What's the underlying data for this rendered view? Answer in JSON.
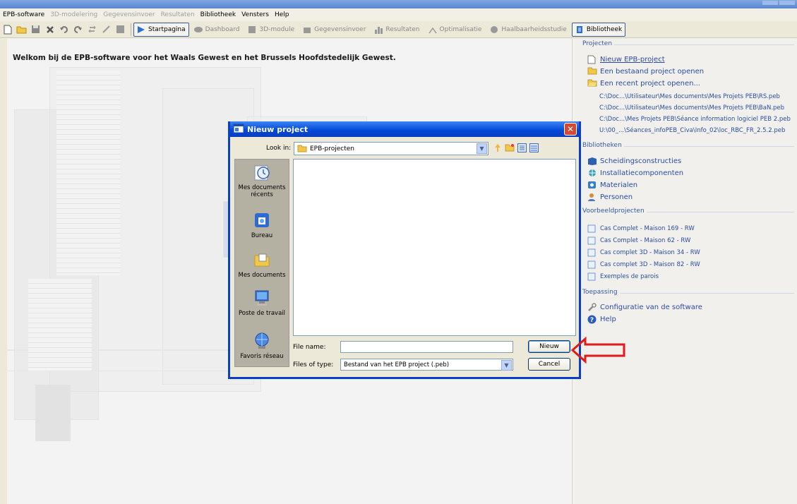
{
  "menubar": {
    "items": [
      {
        "label": "EPB-software",
        "enabled": true
      },
      {
        "label": "3D-modelering",
        "enabled": false
      },
      {
        "label": "Gegevensinvoer",
        "enabled": false
      },
      {
        "label": "Resultaten",
        "enabled": false
      },
      {
        "label": "Bibliotheek",
        "enabled": true
      },
      {
        "label": "Vensters",
        "enabled": true
      },
      {
        "label": "Help",
        "enabled": true
      }
    ]
  },
  "toolbar": {
    "startpagina": "Startpagina",
    "dashboard": "Dashboard",
    "module3d": "3D-module",
    "gegevensinvoer": "Gegevensinvoer",
    "resultaten": "Resultaten",
    "optimalisatie": "Optimalisatie",
    "haalbaarheidsstudie": "Haalbaarheidsstudie",
    "bibliotheek": "Bibliotheek"
  },
  "main": {
    "welcome": "Welkom bij de EPB-software voor het Waals Gewest en het Brussels Hoofdstedelijk Gewest."
  },
  "right_panel": {
    "projecten": {
      "heading": "Projecten",
      "new_project": "Nieuw EPB-project",
      "open_existing": "Een bestaand project openen",
      "open_recent": "Een recent project openen...",
      "recent": [
        "C:\\Doc...\\Utilisateur\\Mes documents\\Mes Projets PEB\\RS.peb",
        "C:\\Doc...\\Utilisateur\\Mes documents\\Mes Projets PEB\\BaN.peb",
        "C:\\Doc...\\Mes Projets PEB\\Séance information logiciel PEB 2.peb",
        "U:\\00_...\\Séances_infoPEB_Civa\\Info_02\\loc_RBC_FR_2.5.2.peb"
      ]
    },
    "bibliotheken": {
      "heading": "Bibliotheken",
      "items": [
        "Scheidingsconstructies",
        "Installatiecomponenten",
        "Materialen",
        "Personen"
      ]
    },
    "voorbeeldprojecten": {
      "heading": "Voorbeeldprojecten",
      "items": [
        "Cas Complet - Maison 169 - RW",
        "Cas Complet - Maison 62 - RW",
        "Cas complet 3D - Maison 34 - RW",
        "Cas complet 3D - Maison 82 - RW",
        "Exemples de parois"
      ]
    },
    "toepassing": {
      "heading": "Toepassing",
      "configure": "Configuratie van de software",
      "help": "Help"
    }
  },
  "dialog": {
    "title": "Nieuw project",
    "close": "✕",
    "look_in_label": "Look in:",
    "look_in_value": "EPB-projecten",
    "places": [
      "Mes documents récents",
      "Bureau",
      "Mes documents",
      "Poste de travail",
      "Favoris réseau"
    ],
    "file_name_label": "File name:",
    "file_name_value": "",
    "file_type_label": "Files of type:",
    "file_type_value": "Bestand van het EPB project (.peb)",
    "new_button": "Nieuw",
    "cancel_button": "Cancel"
  },
  "colors": {
    "dialog_title": "#0047d6",
    "link": "#2b4ba3",
    "arrow": "#e21a1a"
  }
}
